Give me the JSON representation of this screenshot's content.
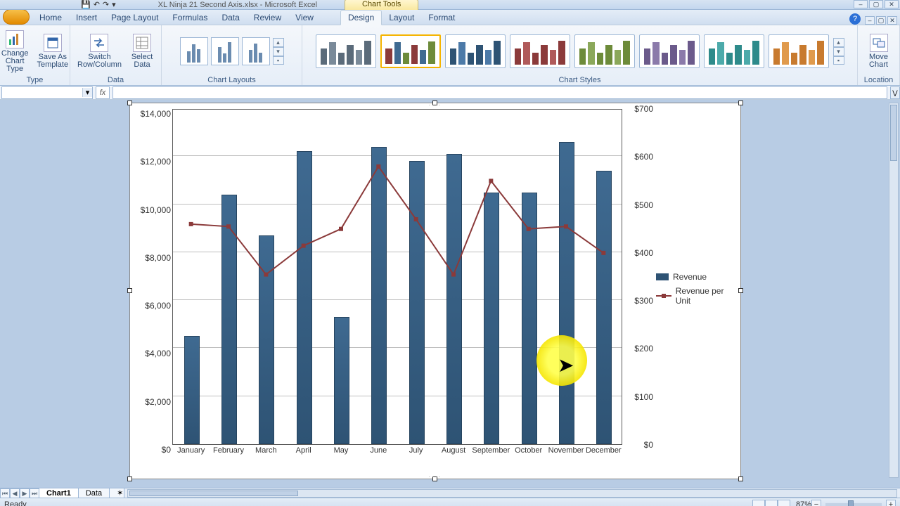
{
  "app": {
    "doc_title": "XL Ninja 21 Second Axis.xlsx - Microsoft Excel",
    "super_tab": "Chart Tools",
    "status": "Ready",
    "zoom_pct": "87%"
  },
  "tabs": {
    "home": "Home",
    "insert": "Insert",
    "page_layout": "Page Layout",
    "formulas": "Formulas",
    "data": "Data",
    "review": "Review",
    "view": "View",
    "design": "Design",
    "layout": "Layout",
    "format": "Format"
  },
  "ribbon": {
    "type_group": "Type",
    "change_chart_type": "Change Chart Type",
    "save_as_template": "Save As Template",
    "data_group": "Data",
    "switch": "Switch Row/Column",
    "select_data": "Select Data",
    "chart_layouts": "Chart Layouts",
    "chart_styles": "Chart Styles",
    "location_group": "Location",
    "move_chart": "Move Chart"
  },
  "fx": {
    "label": "fx"
  },
  "sheets": {
    "chart1": "Chart1",
    "data": "Data"
  },
  "legend": {
    "revenue": "Revenue",
    "rpu": "Revenue per Unit"
  },
  "chart_data": {
    "type": "bar",
    "categories": [
      "January",
      "February",
      "March",
      "April",
      "May",
      "June",
      "July",
      "August",
      "September",
      "October",
      "November",
      "December"
    ],
    "series": [
      {
        "name": "Revenue",
        "axis": "primary",
        "type": "bar",
        "values": [
          4500,
          10400,
          8700,
          12200,
          5300,
          12400,
          11800,
          12100,
          10500,
          10500,
          12600,
          11400
        ]
      },
      {
        "name": "Revenue per Unit",
        "axis": "secondary",
        "type": "line",
        "values": [
          460,
          455,
          355,
          415,
          450,
          580,
          470,
          355,
          550,
          450,
          455,
          400
        ]
      }
    ],
    "ylabel": "",
    "xlabel": "",
    "ylim": [
      0,
      14000
    ],
    "y2lim": [
      0,
      700
    ],
    "yticks_left": [
      "$0",
      "$2,000",
      "$4,000",
      "$6,000",
      "$8,000",
      "$10,000",
      "$12,000",
      "$14,000"
    ],
    "yticks_right": [
      "$0",
      "$100",
      "$200",
      "$300",
      "$400",
      "$500",
      "$600",
      "$700"
    ],
    "title": ""
  }
}
